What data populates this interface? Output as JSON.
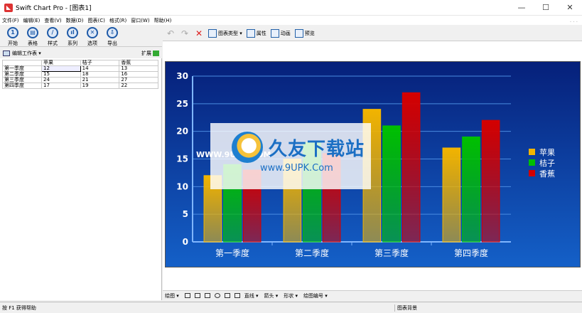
{
  "window": {
    "title": "Swift Chart Pro - [图表1]",
    "minimize": "—",
    "maximize": "☐",
    "close": "✕"
  },
  "menu": [
    "文件(F)",
    "编辑(E)",
    "查看(V)",
    "数据(D)",
    "图表(C)",
    "格式(R)",
    "窗口(W)",
    "帮助(H)"
  ],
  "left_toolbar": [
    {
      "label": "开始",
      "glyph": "1"
    },
    {
      "label": "表格",
      "glyph": "▤"
    },
    {
      "label": "样式",
      "glyph": "/"
    },
    {
      "label": "系列",
      "glyph": "ıl"
    },
    {
      "label": "选项",
      "glyph": "✕"
    },
    {
      "label": "导出",
      "glyph": "⇩"
    }
  ],
  "worksheet": {
    "title": "编辑工作表 ▾",
    "expand_label": "扩展",
    "headers": [
      "",
      "苹果",
      "桔子",
      "香蕉"
    ],
    "rows": [
      [
        "第一季度",
        "12",
        "14",
        "13"
      ],
      [
        "第二季度",
        "15",
        "18",
        "16"
      ],
      [
        "第三季度",
        "24",
        "21",
        "27"
      ],
      [
        "第四季度",
        "17",
        "19",
        "22"
      ]
    ]
  },
  "right_toolbar": {
    "chart_type": "图表类型 ▾",
    "properties": "属性",
    "animation": "动画",
    "preview": "预览"
  },
  "chart_data": {
    "type": "bar",
    "categories": [
      "第一季度",
      "第二季度",
      "第三季度",
      "第四季度"
    ],
    "series": [
      {
        "name": "苹果",
        "values": [
          12,
          15,
          24,
          17
        ],
        "color": "#f2b400"
      },
      {
        "name": "桔子",
        "values": [
          14,
          18,
          21,
          19
        ],
        "color": "#00c000"
      },
      {
        "name": "香蕉",
        "values": [
          13,
          16,
          27,
          22
        ],
        "color": "#d40000"
      }
    ],
    "yticks": [
      0,
      5,
      10,
      15,
      20,
      25,
      30
    ],
    "ylim": [
      0,
      30
    ],
    "grid": true,
    "legend": "right",
    "background": "#0a2a8c"
  },
  "watermark": {
    "main": "久友下载站",
    "url": "www.9UPK.Com",
    "www": "WWW.9UPK.COM"
  },
  "bottom_toolbar": [
    "绘图 ▾",
    "直线 ▾",
    "箭头 ▾",
    "形状 ▾",
    "绘图编号 ▾"
  ],
  "status": {
    "left": "按 F1 获得帮助",
    "mid": "图表背景"
  }
}
